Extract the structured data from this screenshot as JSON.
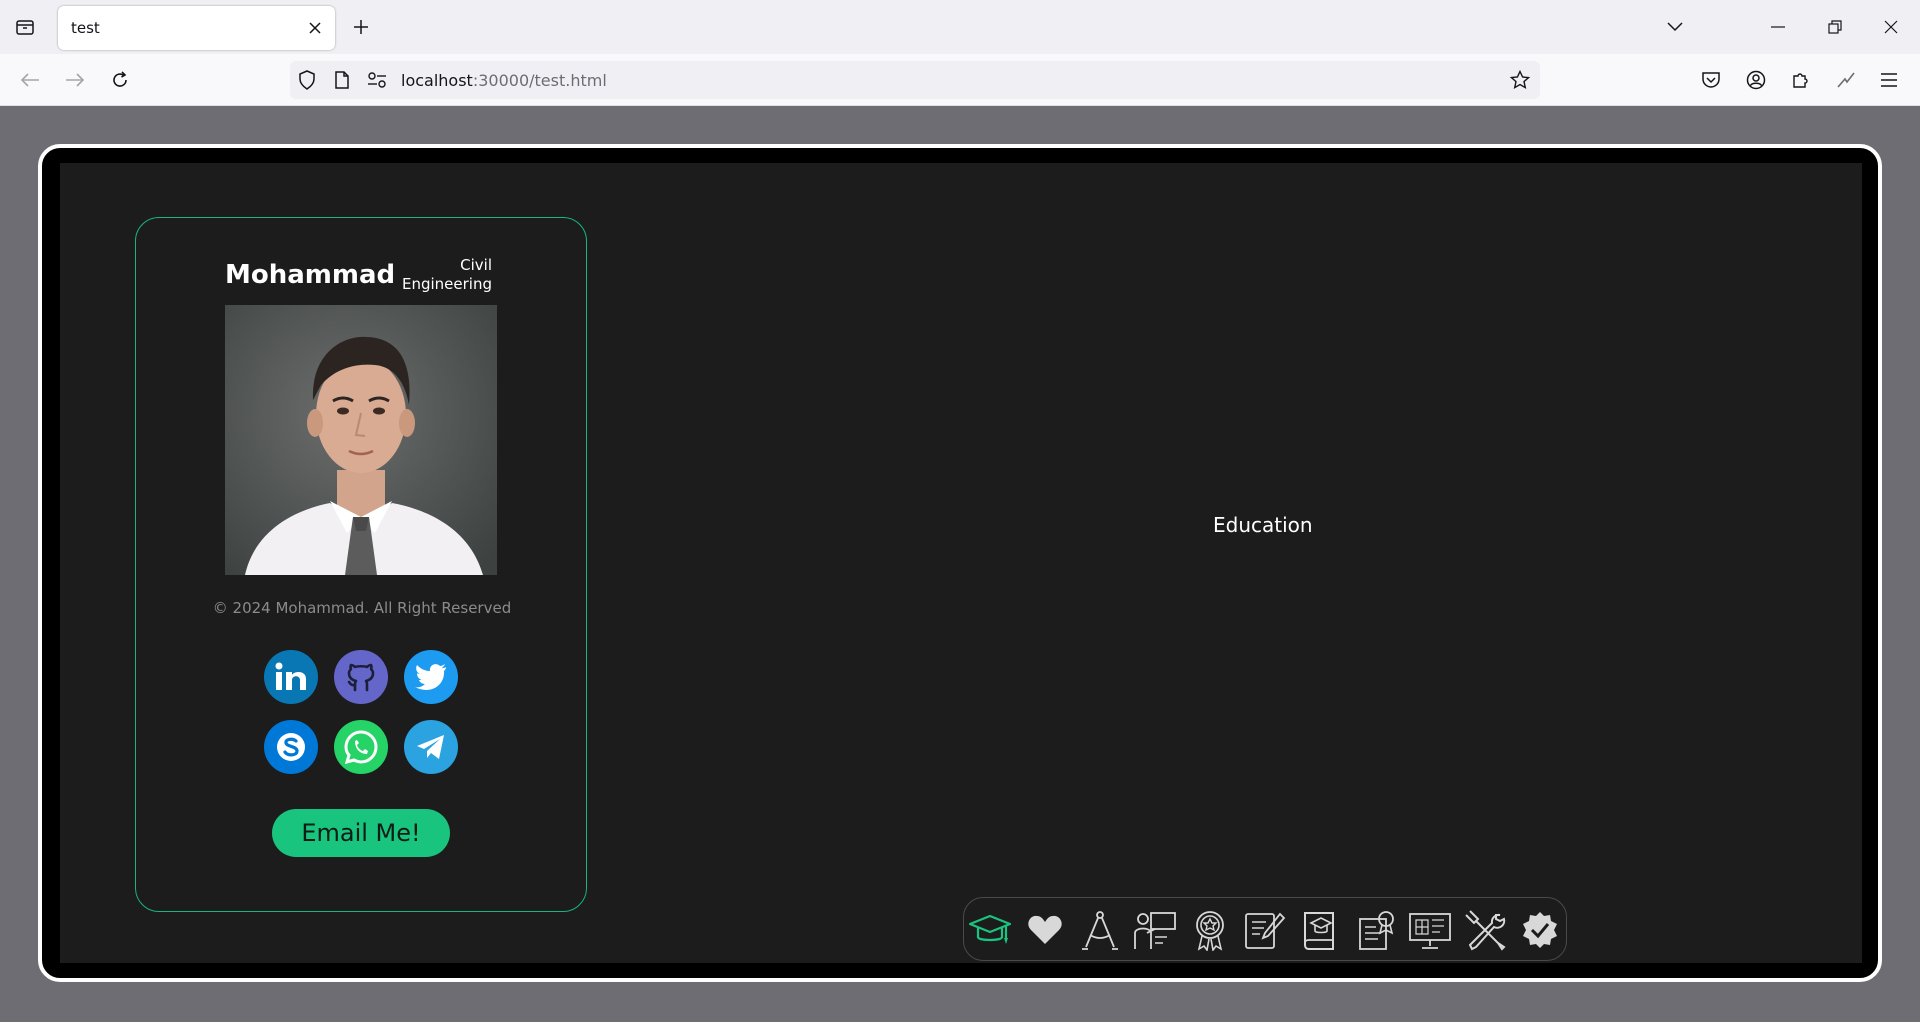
{
  "browser": {
    "tab_title": "test",
    "url_host": "localhost",
    "url_rest": ":30000/test.html"
  },
  "profile": {
    "name": "Mohammad",
    "role_line1": "Civil",
    "role_line2": "Engineering",
    "photo_alt": "Mohammad",
    "copyright": "© 2024 Mohammad. All Right Reserved",
    "email_button": "Email Me!"
  },
  "social_links": [
    {
      "name": "linkedin",
      "color": "#0a77b5"
    },
    {
      "name": "github",
      "color": "#6566c9"
    },
    {
      "name": "twitter",
      "color": "#1d9bf0"
    },
    {
      "name": "skype",
      "color": "#0078d7"
    },
    {
      "name": "whatsapp",
      "color": "#25d366"
    },
    {
      "name": "telegram",
      "color": "#2aa3e0"
    }
  ],
  "main": {
    "section_title": "Education"
  },
  "nav_icons": [
    {
      "name": "graduation-cap-icon",
      "active": true
    },
    {
      "name": "heart-icon",
      "active": false
    },
    {
      "name": "compass-icon",
      "active": false
    },
    {
      "name": "teacher-board-icon",
      "active": false
    },
    {
      "name": "award-medal-icon",
      "active": false
    },
    {
      "name": "edit-document-icon",
      "active": false
    },
    {
      "name": "education-book-icon",
      "active": false
    },
    {
      "name": "certificate-icon",
      "active": false
    },
    {
      "name": "blueprint-monitor-icon",
      "active": false
    },
    {
      "name": "tools-icon",
      "active": false
    },
    {
      "name": "verified-badge-icon",
      "active": false
    }
  ],
  "colors": {
    "accent": "#19c47f",
    "page_bg": "#1c1c1d",
    "outer_bg": "#6e6d73"
  }
}
